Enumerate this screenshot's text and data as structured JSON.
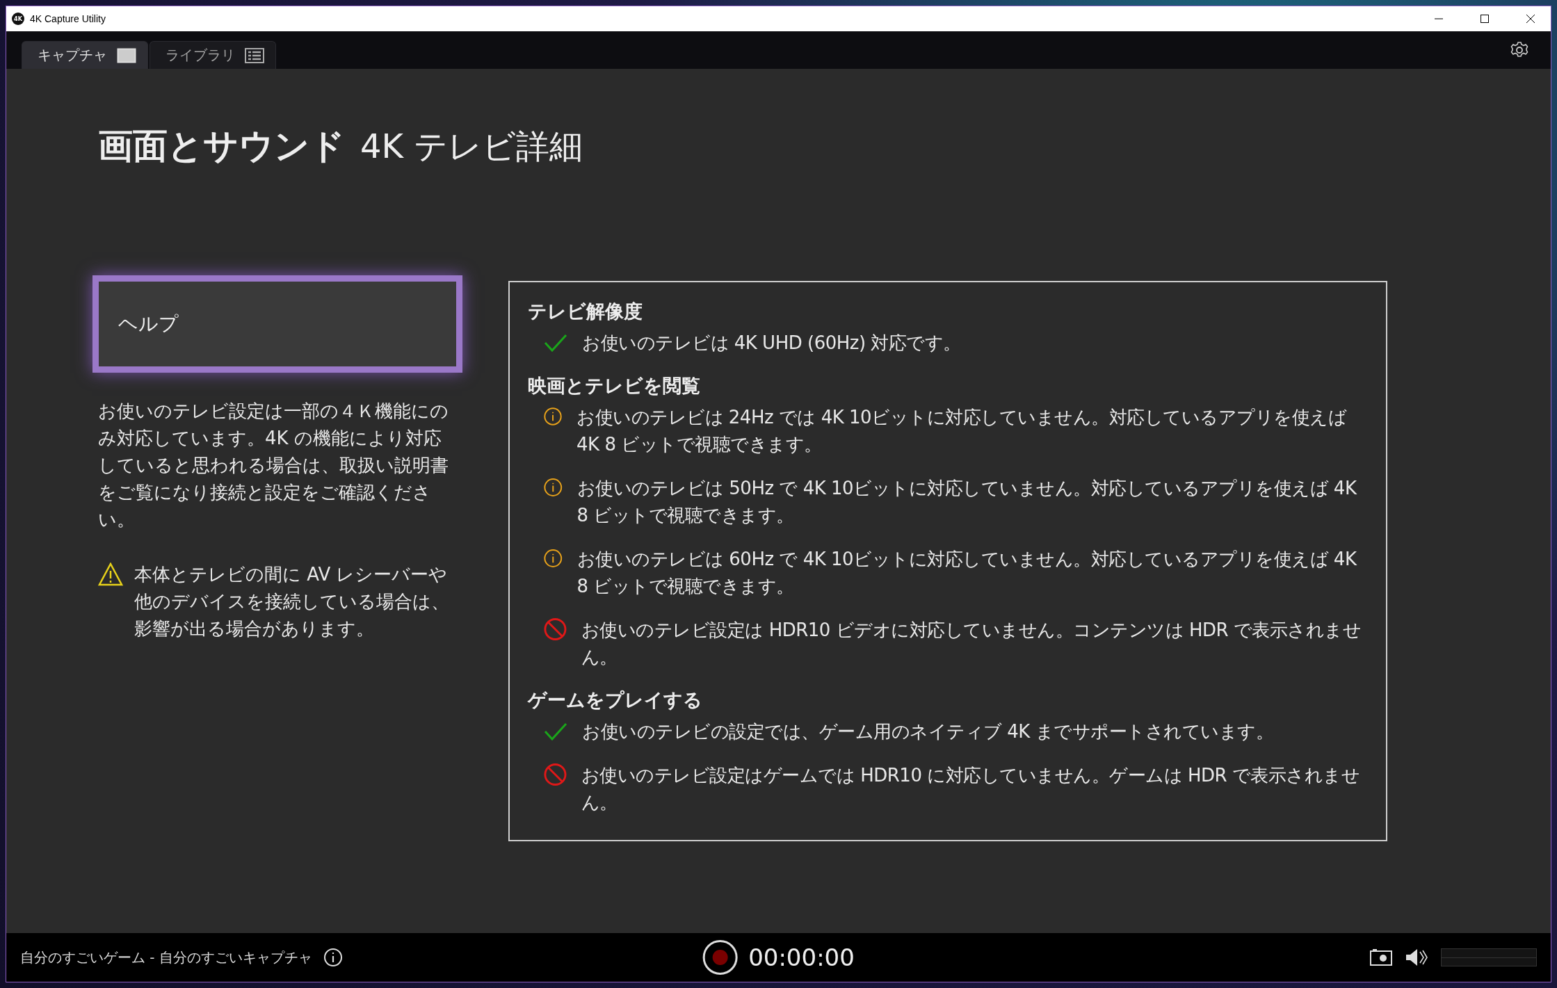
{
  "window": {
    "title": "4K Capture Utility",
    "logo": "4K"
  },
  "tabs": [
    {
      "label": "キャプチャ",
      "kind": "capture",
      "selected": true
    },
    {
      "label": "ライブラリ",
      "kind": "library",
      "selected": false
    }
  ],
  "page": {
    "title": "画面とサウンド",
    "subtitle": "4K テレビ詳細"
  },
  "help_button": {
    "label": "ヘルプ"
  },
  "description": "お使いのテレビ設定は一部の４Ｋ機能にのみ対応しています。4K の機能により対応していると思われる場合は、取扱い説明書をご覧になり接続と設定をご確認ください。",
  "warning": "本体とテレビの間に AV レシーバーや他のデバイスを接続している場合は、影響が出る場合があります。",
  "sections": [
    {
      "heading": "テレビ解像度",
      "items": [
        {
          "kind": "ok",
          "text": "お使いのテレビは 4K UHD (60Hz) 対応です。"
        }
      ]
    },
    {
      "heading": "映画とテレビを閲覧",
      "items": [
        {
          "kind": "info",
          "text": "お使いのテレビは 24Hz では 4K 10ビットに対応していません。対応しているアプリを使えば 4K 8 ビットで視聴できます。"
        },
        {
          "kind": "info",
          "text": "お使いのテレビは 50Hz で 4K 10ビットに対応していません。対応しているアプリを使えば 4K 8 ビットで視聴できます。"
        },
        {
          "kind": "info",
          "text": "お使いのテレビは 60Hz で 4K 10ビットに対応していません。対応しているアプリを使えば 4K 8 ビットで視聴できます。"
        },
        {
          "kind": "error",
          "text": "お使いのテレビ設定は HDR10 ビデオに対応していません。コンテンツは HDR で表示されません。"
        }
      ]
    },
    {
      "heading": "ゲームをプレイする",
      "items": [
        {
          "kind": "ok",
          "text": "お使いのテレビの設定では、ゲーム用のネイティブ 4K までサポートされています。"
        },
        {
          "kind": "error",
          "text": "お使いのテレビ設定はゲームでは HDR10 に対応していません。ゲームは HDR で表示されません。"
        }
      ]
    }
  ],
  "status_bar": {
    "title": "自分のすごいゲーム - 自分のすごいキャプチャ",
    "timer": "00:00:00",
    "recording": false
  }
}
